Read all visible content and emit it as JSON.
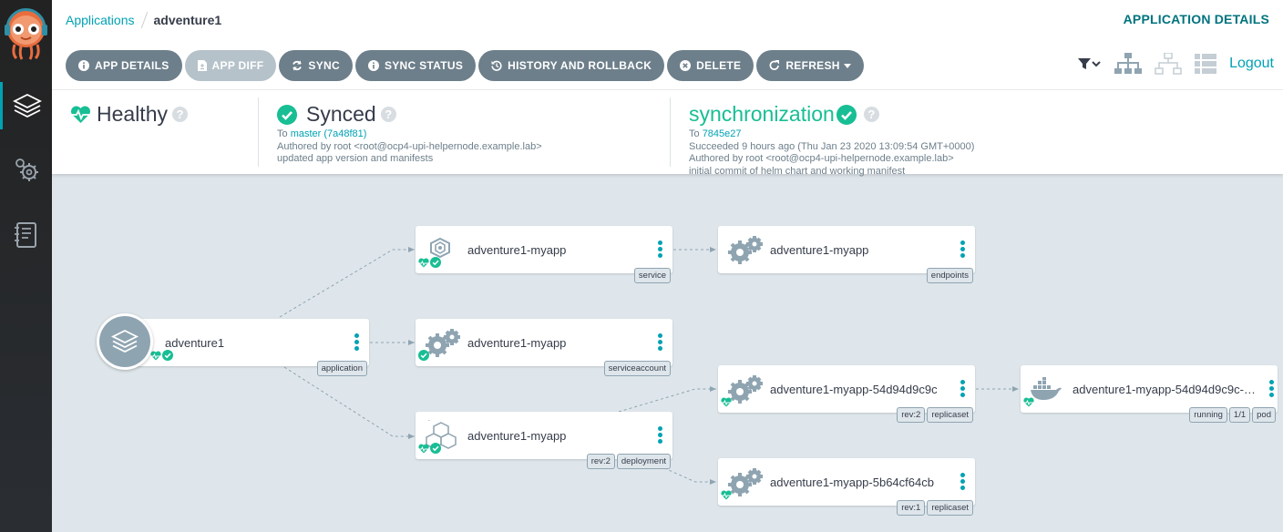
{
  "breadcrumb": {
    "link": "Applications",
    "current": "adventure1"
  },
  "page_title": "APPLICATION DETAILS",
  "actions": [
    {
      "label": "APP DETAILS",
      "icon": "info-icon"
    },
    {
      "label": "APP DIFF",
      "icon": "file-diff-icon",
      "disabled": true
    },
    {
      "label": "SYNC",
      "icon": "sync-icon"
    },
    {
      "label": "SYNC STATUS",
      "icon": "info-icon"
    },
    {
      "label": "HISTORY AND ROLLBACK",
      "icon": "history-icon"
    },
    {
      "label": "DELETE",
      "icon": "delete-icon"
    },
    {
      "label": "REFRESH",
      "icon": "refresh-icon"
    }
  ],
  "logout": "Logout",
  "status": {
    "health": {
      "label": "Healthy"
    },
    "sync": {
      "label": "Synced",
      "to_prefix": "To",
      "revision": "master (7a48f81)",
      "author": "Authored by root <root@ocp4-upi-helpernode.example.lab>",
      "message": "updated app version and manifests"
    },
    "operation": {
      "label": "synchronization",
      "to_prefix": "To",
      "revision": "7845e27",
      "result": "Succeeded 9 hours ago (Thu Jan 23 2020 13:09:54 GMT+0000)",
      "author": "Authored by root <root@ocp4-upi-helpernode.example.lab>",
      "message": "initial commit of helm chart and working manifest"
    }
  },
  "colors": {
    "accent": "#00a2b3",
    "healthy": "#18be94",
    "sidebar": "#2a2e33"
  },
  "nodes": [
    {
      "name": "adventure1",
      "tags": [
        "application"
      ]
    },
    {
      "name": "adventure1-myapp",
      "tags": [
        "service"
      ]
    },
    {
      "name": "adventure1-myapp",
      "tags": [
        "serviceaccount"
      ]
    },
    {
      "name": "adventure1-myapp",
      "tags": [
        "rev:2",
        "deployment"
      ]
    },
    {
      "name": "adventure1-myapp",
      "tags": [
        "endpoints"
      ]
    },
    {
      "name": "adventure1-myapp-54d94d9c9c",
      "tags": [
        "rev:2",
        "replicaset"
      ]
    },
    {
      "name": "adventure1-myapp-5b64cf64cb",
      "tags": [
        "rev:1",
        "replicaset"
      ]
    },
    {
      "name": "adventure1-myapp-54d94d9c9c-5...",
      "tags": [
        "running",
        "1/1",
        "pod"
      ]
    }
  ]
}
